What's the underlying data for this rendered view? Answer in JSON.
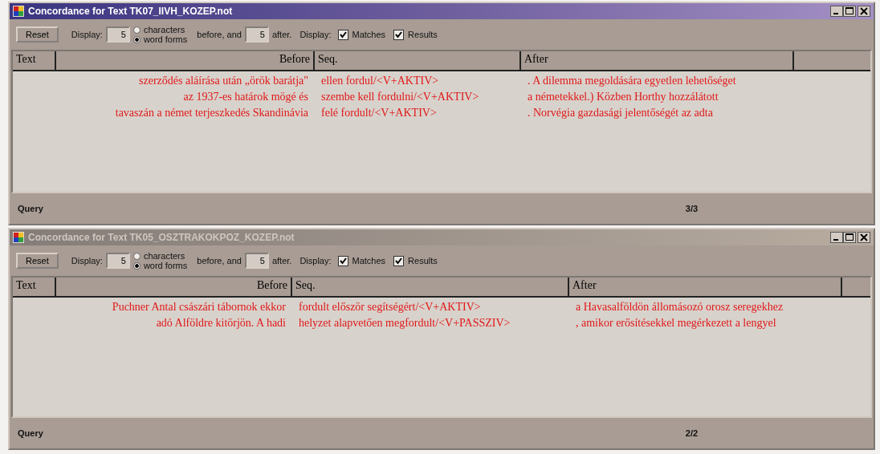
{
  "windows": [
    {
      "title": "Concordance for Text TK07_IIVH_KOZEP.not",
      "active": true,
      "toolbar": {
        "reset": "Reset",
        "display_label": "Display:",
        "before_value": "5",
        "radios": [
          {
            "label": "characters",
            "selected": false
          },
          {
            "label": "word forms",
            "selected": true
          }
        ],
        "before_and": "before, and",
        "after_value": "5",
        "after_label": "after.",
        "display_label_2": "Display:",
        "checks": [
          {
            "label": "Matches",
            "checked": true
          },
          {
            "label": "Results",
            "checked": true
          }
        ]
      },
      "columns": [
        "Text",
        "Before",
        "Seq.",
        "After"
      ],
      "rows": [
        {
          "before": "szerződés aláírása után „örök barátja\"",
          "seq": "ellen fordul/<V+AKTIV>",
          "after": ". A dilemma megoldására egyetlen lehetőséget"
        },
        {
          "before": "az 1937-es határok mögé és",
          "seq": "szembe kell fordulni/<V+AKTIV>",
          "after": "a németekkel.) Közben Horthy hozzálátott"
        },
        {
          "before": "tavaszán a német terjeszkedés Skandinávia",
          "seq": "felé fordult/<V+AKTIV>",
          "after": ". Norvégia gazdasági jelentőségét az adta"
        }
      ],
      "status": {
        "label": "Query",
        "count": "3/3"
      }
    },
    {
      "title": "Concordance for Text TK05_OSZTRAKOKPOZ_KOZEP.not",
      "active": false,
      "toolbar": {
        "reset": "Reset",
        "display_label": "Display:",
        "before_value": "5",
        "radios": [
          {
            "label": "characters",
            "selected": false
          },
          {
            "label": "word forms",
            "selected": true
          }
        ],
        "before_and": "before, and",
        "after_value": "5",
        "after_label": "after.",
        "display_label_2": "Display:",
        "checks": [
          {
            "label": "Matches",
            "checked": true
          },
          {
            "label": "Results",
            "checked": true
          }
        ]
      },
      "columns": [
        "Text",
        "Before",
        "Seq.",
        "After"
      ],
      "rows": [
        {
          "before": "Puchner Antal császári tábornok ekkor",
          "seq": "fordult először segítségért/<V+AKTIV>",
          "after": "a Havasalföldön állomásozó orosz seregekhez"
        },
        {
          "before": "adó Alföldre kitörjön. A hadi",
          "seq": "helyzet alapvetően megfordult/<V+PASSZIV>",
          "after": ", amikor erősítésekkel megérkezett a lengyel"
        }
      ],
      "status": {
        "label": "Query",
        "count": "2/2"
      }
    }
  ]
}
